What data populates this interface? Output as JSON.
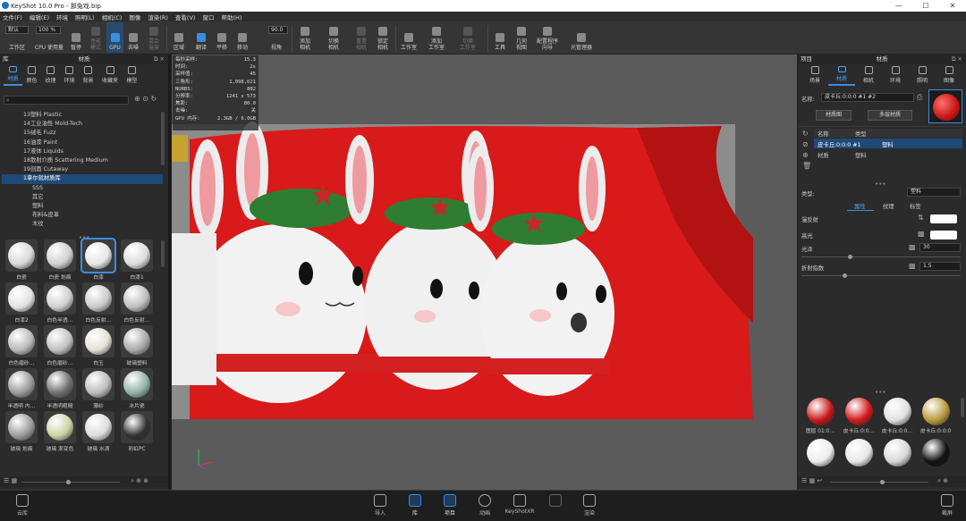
{
  "window": {
    "title": "KeyShot 10.0 Pro  -  那兔戏.bip"
  },
  "menu": [
    "文件(F)",
    "编辑(E)",
    "环境",
    "照明(L)",
    "相机(C)",
    "图像",
    "渲染(R)",
    "查看(V)",
    "窗口",
    "帮助(H)"
  ],
  "toolbar": {
    "workspace_value": "默认",
    "zoom_value": "100 %",
    "fov_value": "90.0",
    "items": [
      {
        "label": "工作区"
      },
      {
        "label": "CPU 使用量"
      },
      {
        "label": "暂停"
      },
      {
        "label": "性能\n模式"
      },
      {
        "label": "GPU"
      },
      {
        "label": "去噪"
      },
      {
        "label": "混合\n渲染"
      },
      {
        "label": "区域"
      },
      {
        "label": "翻译"
      },
      {
        "label": "平移"
      },
      {
        "label": "移动"
      },
      {
        "label": "视角"
      },
      {
        "label": "添加\n相机"
      },
      {
        "label": "切换\n相机"
      },
      {
        "label": "重置\n相机"
      },
      {
        "label": "锁定\n相机"
      },
      {
        "label": "工作室"
      },
      {
        "label": "添加\n工作室"
      },
      {
        "label": "切换\n工作室"
      },
      {
        "label": "工具"
      },
      {
        "label": "几何\n视图"
      },
      {
        "label": "配置程序\n向导"
      },
      {
        "label": "光管理器"
      }
    ]
  },
  "library": {
    "header": "材质",
    "short_title": "库",
    "tabs": [
      "材质",
      "颜色",
      "纹理",
      "环境",
      "背景",
      "收藏夹",
      "模型"
    ],
    "tree": [
      {
        "label": "13塑料 Plastic"
      },
      {
        "label": "14工业油性 Mold-Tech"
      },
      {
        "label": "15绒毛 Fuzz"
      },
      {
        "label": "16油漆 Paint"
      },
      {
        "label": "17液体 Liquids"
      },
      {
        "label": "18散射介质 Scattering Medium"
      },
      {
        "label": "19剖面 Cutaway"
      },
      {
        "label": "1拿尔就材质库"
      },
      {
        "label": "SSS"
      },
      {
        "label": "其它"
      },
      {
        "label": "塑料"
      },
      {
        "label": "布料&皮革"
      },
      {
        "label": "木纹"
      }
    ],
    "materials": [
      {
        "label": "白瓷",
        "color": "#d8d8d8"
      },
      {
        "label": "白瓷 划痕",
        "color": "#cfcfcf"
      },
      {
        "label": "白漆",
        "color": "#e6e6e6"
      },
      {
        "label": "白漆1",
        "color": "#dcdcdc"
      },
      {
        "label": "白漆2",
        "color": "#e2e2e2"
      },
      {
        "label": "白色半透…",
        "color": "#d0d0d0"
      },
      {
        "label": "白色反射…",
        "color": "#c9c9c9"
      },
      {
        "label": "白色反射…",
        "color": "#bebebe"
      },
      {
        "label": "白色磨砂…",
        "color": "#b9b9b9"
      },
      {
        "label": "白色磨砂…",
        "color": "#c1c1c1"
      },
      {
        "label": "白玉",
        "color": "#e4e2d6"
      },
      {
        "label": "玻璃塑料",
        "color": "#a8a8a8"
      },
      {
        "label": "半透明 内…",
        "color": "#9a9a9a"
      },
      {
        "label": "半透明粗糙",
        "color": "#707070"
      },
      {
        "label": "薄纱",
        "color": "#bcbcbc"
      },
      {
        "label": "冰片瓷",
        "color": "#8fb3a5"
      },
      {
        "label": "玻璃 划痕",
        "color": "#9c9c9c"
      },
      {
        "label": "玻璃 渐变色",
        "color": "#c9d2a4"
      },
      {
        "label": "玻璃 水滴",
        "color": "#dcdcdc"
      },
      {
        "label": "彩虹PC",
        "color": "#303030"
      }
    ]
  },
  "stats": [
    {
      "k": "每秒采样:",
      "v": "15.3"
    },
    {
      "k": "时间:",
      "v": "2s"
    },
    {
      "k": "采样值:",
      "v": "45"
    },
    {
      "k": "三角形:",
      "v": "1,098,621"
    },
    {
      "k": "NURBS:",
      "v": "882"
    },
    {
      "k": "分辨率:",
      "v": "1241 x 573"
    },
    {
      "k": "焦距:",
      "v": "80.0"
    },
    {
      "k": "去噪:",
      "v": "关"
    },
    {
      "k": "GPU 内存:",
      "v": "2.3GB / 6.0GB"
    }
  ],
  "project": {
    "header": "材质",
    "short_title": "项目",
    "tabs": [
      "场景",
      "材质",
      "相机",
      "环境",
      "照明",
      "图像"
    ],
    "name_label": "名称:",
    "name_value": "皮卡丘:0:0:0 #1 #2",
    "btn_material_graph": "材质图",
    "btn_multi_material": "多层材质",
    "list_headers": [
      "名称",
      "类型"
    ],
    "list_rows": [
      {
        "name": "皮卡丘:0:0:0 #1",
        "type": "塑料"
      },
      {
        "name": "材质",
        "type": "塑料"
      }
    ],
    "type_label": "类型:",
    "type_value": "塑料",
    "sub_tabs": [
      "属性",
      "纹理",
      "标签"
    ],
    "props": [
      {
        "label": "漫反射"
      },
      {
        "label": "高光"
      },
      {
        "label": "光泽",
        "value": "30"
      },
      {
        "label": "折射指数",
        "value": "1.5"
      }
    ],
    "swatches": [
      {
        "label": "图层 01:0…",
        "color": "#c81818"
      },
      {
        "label": "皮卡丘:0:0…",
        "color": "#d21a1a"
      },
      {
        "label": "皮卡丘:0:0…",
        "color": "#e0e0e0"
      },
      {
        "label": "皮卡丘:0:0:0",
        "color": "#b89a3a"
      },
      {
        "label": "",
        "color": "#ececec"
      },
      {
        "label": "",
        "color": "#e8e8e8"
      },
      {
        "label": "",
        "color": "#d8d8d8"
      },
      {
        "label": "",
        "color": "#111111"
      }
    ]
  },
  "bottom": {
    "left": "云库",
    "items": [
      {
        "label": "导入"
      },
      {
        "label": "库"
      },
      {
        "label": "项目"
      },
      {
        "label": "动画"
      },
      {
        "label": "KeyShotXR"
      },
      {
        "label": "渲染"
      }
    ],
    "right": "截屏"
  },
  "colors": {
    "accent": "#3a8de0",
    "flag_red": "#d81a1a"
  }
}
